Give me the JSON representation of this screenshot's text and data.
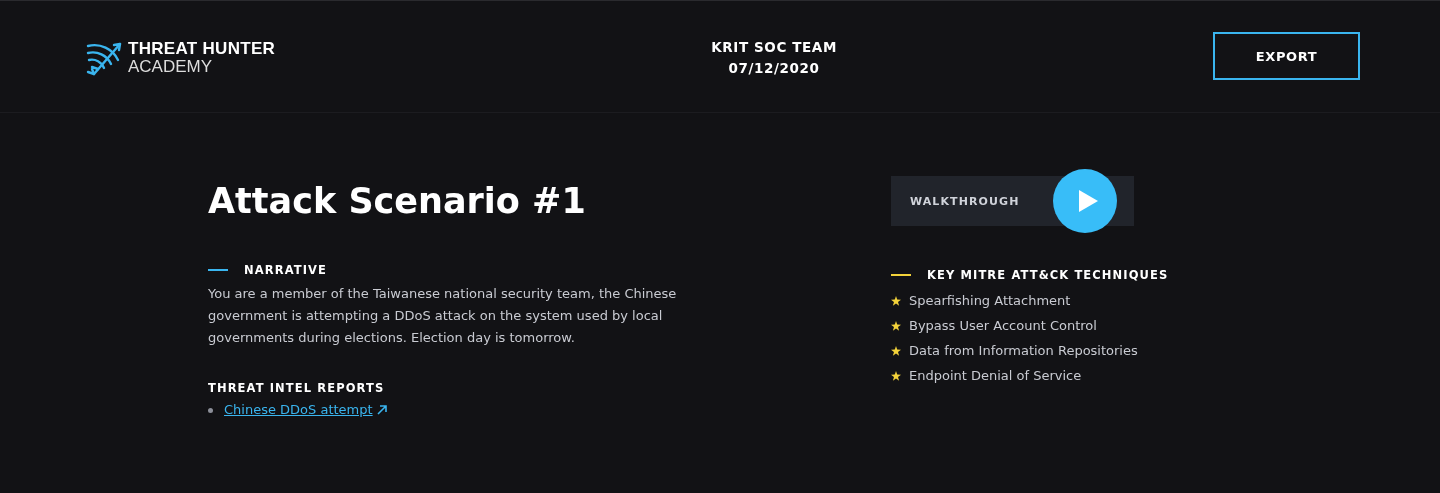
{
  "header": {
    "logo": {
      "line1": "THREAT HUNTER",
      "line2": "ACADEMY"
    },
    "team": "KRIT SOC TEAM",
    "date": "07/12/2020",
    "export_button": "EXPORT"
  },
  "scenario": {
    "title": "Attack Scenario #1",
    "narrative": {
      "heading": "NARRATIVE",
      "text": "You are a member of the Taiwanese national security team, the Chinese government is attempting a DDoS attack on the system used by local governments during elections. Election day is tomorrow."
    },
    "reports": {
      "heading": "THREAT INTEL REPORTS",
      "links": [
        {
          "label": "Chinese DDoS attempt"
        }
      ]
    }
  },
  "walkthrough": {
    "label": "WALKTHROUGH"
  },
  "techniques": {
    "heading": "KEY MITRE ATT&CK TECHNIQUES",
    "items": [
      {
        "label": "Spearfishing Attachment"
      },
      {
        "label": "Bypass User Account Control"
      },
      {
        "label": "Data from Information Repositories"
      },
      {
        "label": "Endpoint Denial of Service"
      }
    ]
  }
}
